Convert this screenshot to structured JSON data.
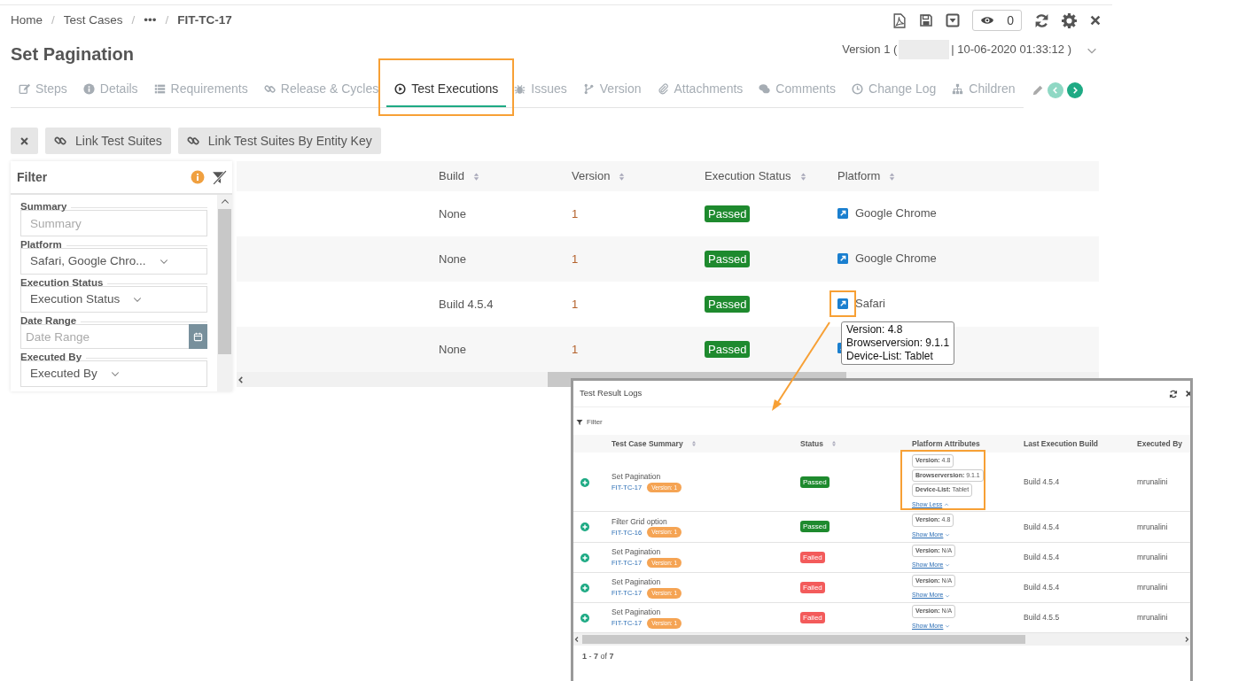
{
  "breadcrumb_separator": "/",
  "breadcrumb": [
    {
      "label": "Home",
      "current": false
    },
    {
      "label": "Test Cases",
      "current": false
    },
    {
      "label": "•••",
      "current": false
    },
    {
      "label": "FIT-TC-17",
      "current": true
    }
  ],
  "title": "Set Pagination",
  "watchers": {
    "count": "0"
  },
  "version_info": {
    "prefix": "Version 1 (",
    "suffix": "| 10-06-2020 01:33:12 )"
  },
  "tabs": [
    {
      "label": "Steps",
      "selected": false
    },
    {
      "label": "Details",
      "selected": false
    },
    {
      "label": "Requirements",
      "selected": false
    },
    {
      "label": "Release & Cycles",
      "selected": false
    },
    {
      "label": "Test Executions",
      "selected": true
    },
    {
      "label": "Issues",
      "selected": false
    },
    {
      "label": "Version",
      "selected": false
    },
    {
      "label": "Attachments",
      "selected": false
    },
    {
      "label": "Comments",
      "selected": false
    },
    {
      "label": "Change Log",
      "selected": false
    },
    {
      "label": "Children",
      "selected": false
    }
  ],
  "tab_scroller": {
    "previous": {
      "disabled": true
    },
    "next": {
      "disabled": false
    }
  },
  "actions": [
    "Link Test Suites",
    "Link Test Suites By Entity Key"
  ],
  "filter": {
    "title": "Filter",
    "fields": [
      {
        "label": "Summary",
        "kind": "text",
        "placeholder": "Summary"
      },
      {
        "label": "Platform",
        "kind": "select",
        "value": "Safari, Google Chro..."
      },
      {
        "label": "Execution Status",
        "kind": "select",
        "value": "Execution Status"
      },
      {
        "label": "Date Range",
        "kind": "date",
        "placeholder": "Date Range"
      },
      {
        "label": "Executed By",
        "kind": "select",
        "value": "Executed By"
      }
    ]
  },
  "table": {
    "columns": [
      "Build",
      "Version",
      "Execution Status",
      "Platform"
    ],
    "rows": [
      {
        "build": "None",
        "version": "1",
        "status": {
          "label": "Passed",
          "kind": "passed"
        },
        "platform": "Google Chrome"
      },
      {
        "build": "None",
        "version": "1",
        "status": {
          "label": "Passed",
          "kind": "passed"
        },
        "platform": "Google Chrome"
      },
      {
        "build": "Build 4.5.4",
        "version": "1",
        "status": {
          "label": "Passed",
          "kind": "passed"
        },
        "platform": "Safari",
        "tooltip": [
          "Version: 4.8",
          "Browserversion: 9.1.1",
          "Device-List: Tablet"
        ]
      },
      {
        "build": "None",
        "version": "1",
        "status": {
          "label": "Passed",
          "kind": "passed"
        }
      }
    ]
  },
  "popup": {
    "title": "Test Result Logs",
    "filter": "Filter",
    "columns": [
      "Test Case Summary",
      "Status",
      "Platform Attributes",
      "Last Execution Build",
      "Executed By"
    ],
    "rows": [
      {
        "summary": "Set Pagination",
        "key": "FIT-TC-17",
        "version": "Version: 1",
        "status": {
          "label": "Passed",
          "kind": "passed"
        },
        "attributes": [
          "**Version:** 4.8",
          "**Browserversion:** 9.1.1",
          "**Device-List:** Tablet"
        ],
        "toggle": {
          "label": "Show Less",
          "expanded": true
        },
        "build": "Build 4.5.4",
        "executed_by": "mrunalini"
      },
      {
        "summary": "Filter Grid option",
        "key": "FIT-TC-16",
        "version": "Version: 1",
        "status": {
          "label": "Passed",
          "kind": "passed"
        },
        "attributes": [
          "**Version:** 4.8"
        ],
        "toggle": {
          "label": "Show More",
          "expanded": false
        },
        "build": "Build 4.5.4",
        "executed_by": "mrunalini"
      },
      {
        "summary": "Set Pagination",
        "key": "FIT-TC-17",
        "version": "Version: 1",
        "status": {
          "label": "Failed",
          "kind": "failed"
        },
        "attributes": [
          "**Version:** N/A"
        ],
        "toggle": {
          "label": "Show More",
          "expanded": false
        },
        "build": "Build 4.5.4",
        "executed_by": "mrunalini"
      },
      {
        "summary": "Set Pagination",
        "key": "FIT-TC-17",
        "version": "Version: 1",
        "status": {
          "label": "Failed",
          "kind": "failed"
        },
        "attributes": [
          "**Version:** N/A"
        ],
        "toggle": {
          "label": "Show More",
          "expanded": false
        },
        "build": "Build 4.5.4",
        "executed_by": "mrunalini"
      },
      {
        "summary": "Set Pagination",
        "key": "FIT-TC-17",
        "version": "Version: 1",
        "status": {
          "label": "Failed",
          "kind": "failed"
        },
        "attributes": [
          "**Version:** N/A"
        ],
        "toggle": {
          "label": "Show More",
          "expanded": false
        },
        "build": "Build 4.5.5",
        "executed_by": "mrunalini"
      }
    ],
    "pagination": "**1** - **7** of **7**"
  }
}
